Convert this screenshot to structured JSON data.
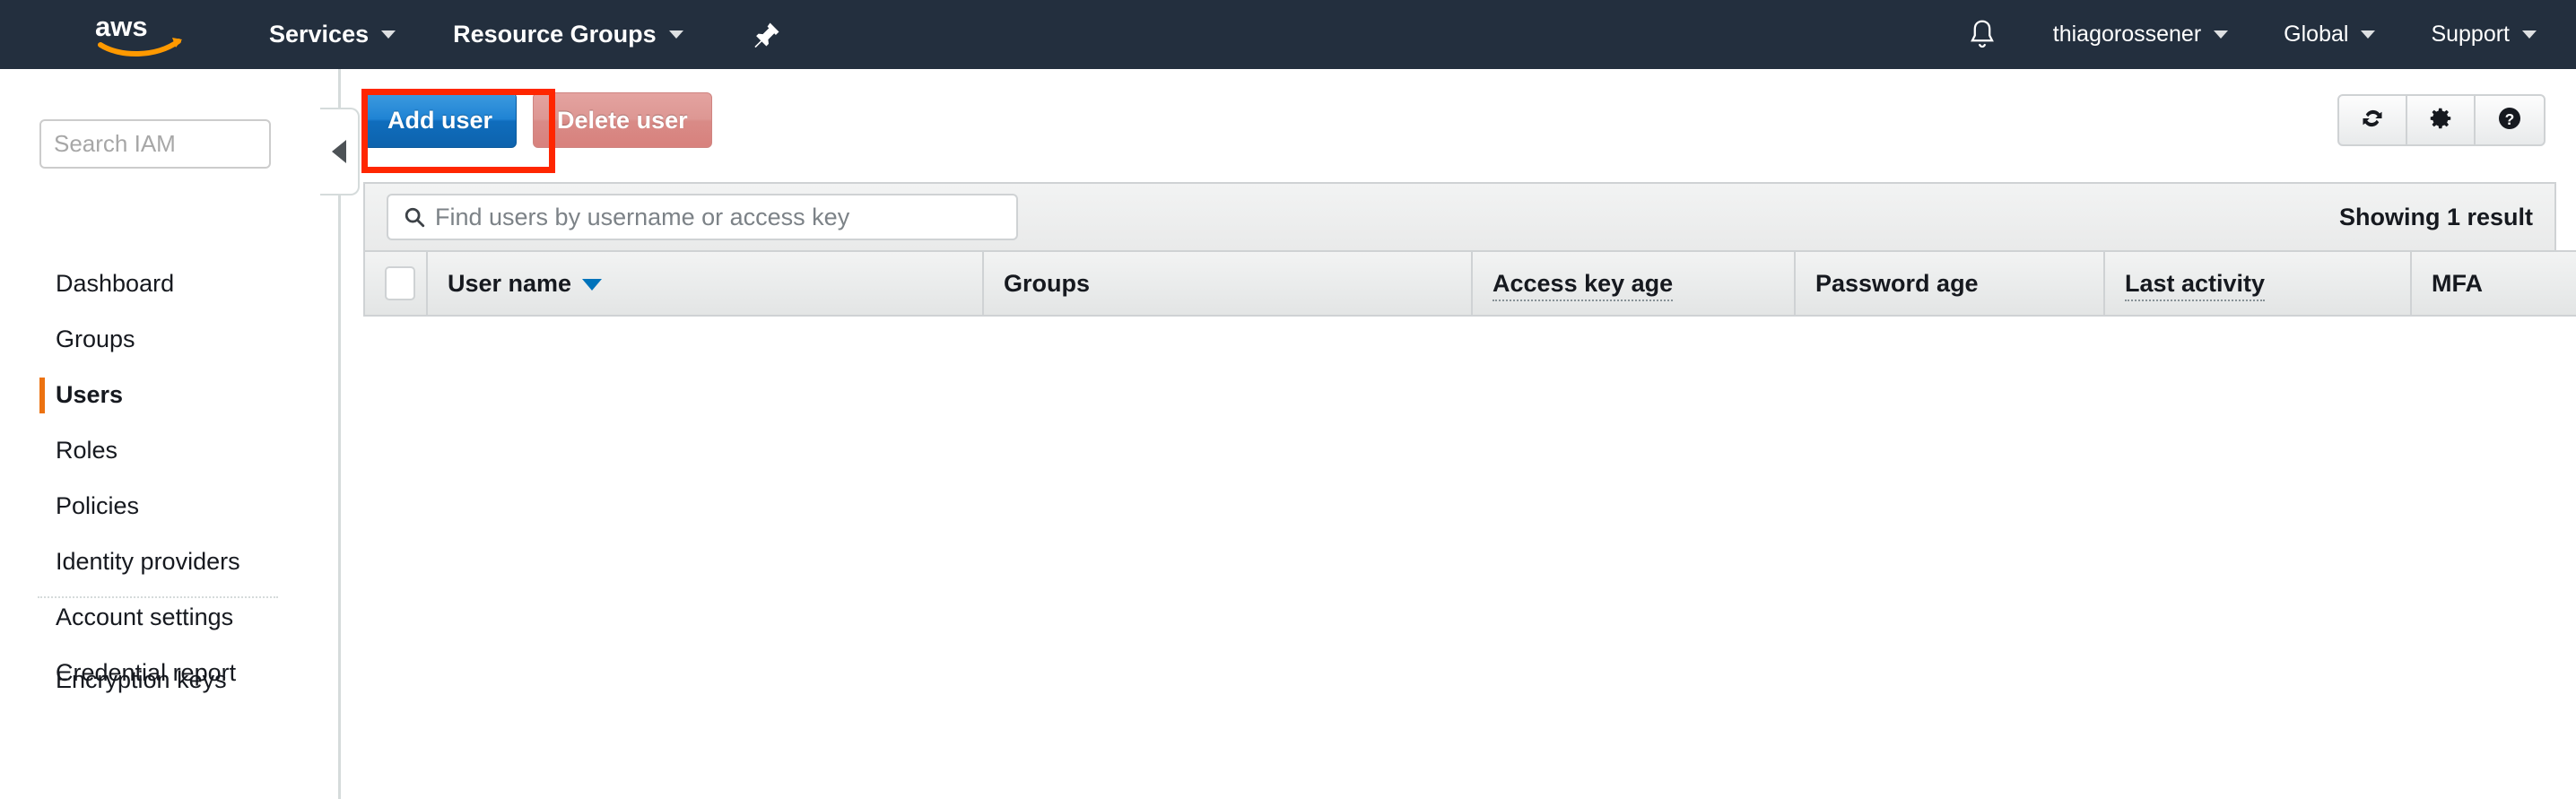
{
  "navbar": {
    "logo_alt": "aws",
    "items": [
      {
        "label": "Services",
        "has_caret": true
      },
      {
        "label": "Resource Groups",
        "has_caret": true
      }
    ],
    "pin_icon": "pushpin-icon",
    "bell_icon": "notifications-bell-icon",
    "right_items": [
      {
        "label": "thiagorossener",
        "has_caret": true
      },
      {
        "label": "Global",
        "has_caret": true
      },
      {
        "label": "Support",
        "has_caret": true
      }
    ]
  },
  "sidebar": {
    "search_placeholder": "Search IAM",
    "search_value": "",
    "items": [
      {
        "label": "Dashboard",
        "active": false
      },
      {
        "label": "Groups",
        "active": false
      },
      {
        "label": "Users",
        "active": true
      },
      {
        "label": "Roles",
        "active": false
      },
      {
        "label": "Policies",
        "active": false
      },
      {
        "label": "Identity providers",
        "active": false
      },
      {
        "label": "Account settings",
        "active": false
      },
      {
        "label": "Credential report",
        "active": false
      }
    ],
    "lower_item": {
      "label": "Encryption keys"
    },
    "collapse_icon": "collapse-left-triangle-icon"
  },
  "toolbar": {
    "add_user_label": "Add user",
    "delete_user_label": "Delete user",
    "delete_user_disabled": true,
    "highlight_color": "#ff2600",
    "icon_buttons": [
      {
        "name": "refresh-icon"
      },
      {
        "name": "gear-icon"
      },
      {
        "name": "help-icon"
      }
    ]
  },
  "table": {
    "search_placeholder": "Find users by username or access key",
    "search_value": "",
    "search_icon": "search-magnifier-icon",
    "result_count_label": "Showing 1 result",
    "select_all_checked": false,
    "columns": [
      {
        "label": "User name",
        "sortable": true,
        "sort_direction": "desc",
        "dotted": false
      },
      {
        "label": "Groups",
        "sortable": false,
        "dotted": false
      },
      {
        "label": "Access key age",
        "sortable": false,
        "dotted": true
      },
      {
        "label": "Password age",
        "sortable": false,
        "dotted": false
      },
      {
        "label": "Last activity",
        "sortable": false,
        "dotted": true
      },
      {
        "label": "MFA",
        "sortable": false,
        "dotted": false
      }
    ],
    "rows": []
  },
  "colors": {
    "navbar_bg": "#232f3e",
    "accent_orange": "#ec7211",
    "primary_blue": "#1f83d4",
    "sort_blue": "#0073bb",
    "highlight_red": "#ff2600"
  }
}
